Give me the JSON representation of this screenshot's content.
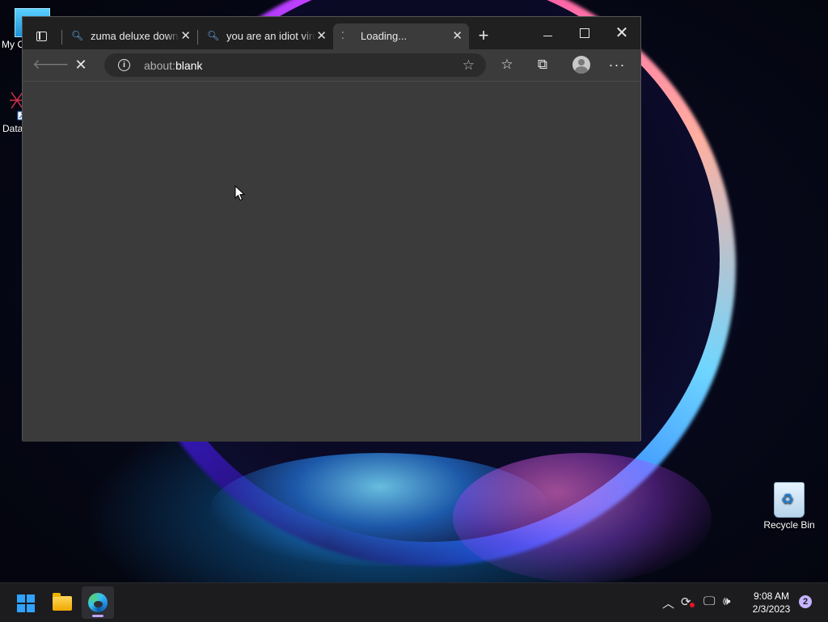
{
  "desktop": {
    "icons": [
      {
        "label": "My C"
      },
      {
        "label": "Data"
      },
      {
        "label": "Recycle Bin"
      }
    ]
  },
  "browser": {
    "tabs": [
      {
        "label": "zuma deluxe downl",
        "icon": "search-icon"
      },
      {
        "label": "you are an idiot viru",
        "icon": "search-icon"
      },
      {
        "label": "Loading...",
        "icon": "loading-spinner-icon"
      }
    ],
    "new_tab_glyph": "+",
    "address": {
      "prefix": "about:",
      "value": "blank"
    },
    "menu_glyph": "···"
  },
  "taskbar": {
    "time": "9:08 AM",
    "date": "2/3/2023",
    "notification_count": "2"
  },
  "colors": {
    "taskbar_bg": "#1c1c1f",
    "browser_bg": "#3b3b3b",
    "titlebar_bg": "#202020",
    "accent": "#2fa3ff"
  }
}
